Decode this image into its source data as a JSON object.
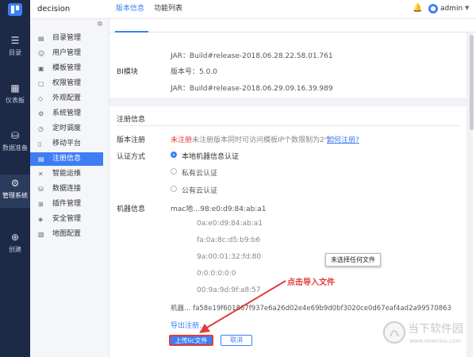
{
  "app": {
    "title": "decision",
    "user": "admin"
  },
  "leftnav": [
    {
      "label": "目录",
      "icon": "grid-icon"
    },
    {
      "label": "仪表板",
      "icon": "dashboard-icon"
    },
    {
      "label": "数据准备",
      "icon": "database-icon"
    },
    {
      "label": "管理系统",
      "icon": "gear-icon",
      "active": true
    },
    {
      "label": "创建",
      "icon": "plus-icon"
    }
  ],
  "submenu": [
    "目录管理",
    "用户管理",
    "模板管理",
    "权限管理",
    "外观配置",
    "系统管理",
    "定时调度",
    "移动平台",
    "注册信息",
    "智能运维",
    "数据连接",
    "插件管理",
    "安全管理",
    "地图配置"
  ],
  "submenu_active": "注册信息",
  "tabs": {
    "version": "版本信息",
    "features": "功能列表"
  },
  "version_card": {
    "jar1": "JAR：Build#release-2018.06.28.22.58.01.761",
    "bi_label": "BI模块",
    "bi_version": "版本号：5.0.0",
    "jar2": "JAR：Build#release-2018.06.29.09.16.39.989"
  },
  "registration": {
    "title": "注册信息",
    "version_label": "版本注册",
    "status": "未注册",
    "status_note": "未注册版本同时可访问模板IP个数限制为2个！",
    "how_link": "如何注册?",
    "auth_label": "认证方式",
    "auth_options": [
      "本地机器信息认证",
      "私有云认证",
      "公有云认证"
    ],
    "machine_label": "机器信息",
    "mac_lines": [
      "mac地…98:e0:d9:84:ab:a1",
      "0a:e0:d9:84:ab:a1",
      "fa:0a:8c:d5:b9:b6",
      "9a:00:01:32:fd:80",
      "0:0:0:0:0:0",
      "00:9a:9d:9f:a8:57"
    ],
    "machine_code": "机器… fa58e19f601867f937e6a26d02e4e69b9d0bf3020ce0d67eaf4ad2a99570863",
    "export_link": "导出注册…",
    "upload_label": "上传lic文件",
    "cancel_label": "取消"
  },
  "tooltip": "未选择任何文件",
  "annotation": "点击导入文件",
  "watermark": {
    "title": "当下软件园",
    "url": "www.downxia.com"
  },
  "colors": {
    "accent": "#3d7ef5",
    "nav_bg": "#1c2a48",
    "warning": "#e23b3b"
  }
}
